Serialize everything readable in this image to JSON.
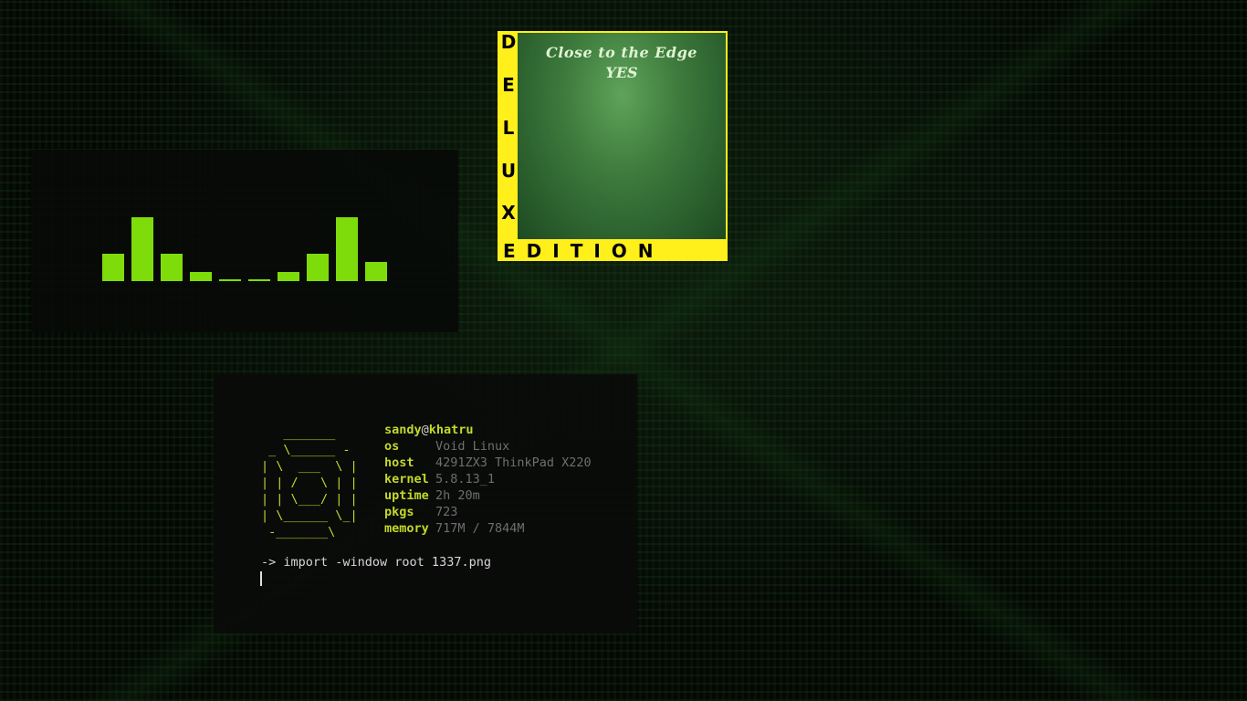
{
  "colors": {
    "accent_green": "#7fdc0b",
    "terminal_yellow": "#c2d92a",
    "album_yellow": "#ffef1a",
    "background": "#000000"
  },
  "visualizer": {
    "levels": [
      0.43,
      1.0,
      0.43,
      0.14,
      0.02,
      0.02,
      0.14,
      0.43,
      1.0,
      0.3
    ]
  },
  "album": {
    "title": "Close to the Edge",
    "band": "YES",
    "side_letters": [
      "D",
      "E",
      "L",
      "U",
      "X"
    ],
    "bottom_text": "EDITION"
  },
  "terminal": {
    "ascii_logo": "   _______\n _ \\______ -\n| \\  ___  \\ |\n| | /   \\ | |\n| | \\___/ | |\n| \\______ \\_|\n -_______\\",
    "user": "sandy",
    "at": "@",
    "host": "khatru",
    "info": [
      {
        "key": "os",
        "value": "Void Linux"
      },
      {
        "key": "host",
        "value": "4291ZX3 ThinkPad X220"
      },
      {
        "key": "kernel",
        "value": "5.8.13_1"
      },
      {
        "key": "uptime",
        "value": "2h 20m"
      },
      {
        "key": "pkgs",
        "value": "723"
      },
      {
        "key": "memory",
        "value": "717M / 7844M"
      }
    ],
    "prompt": "-> import -window root 1337.png"
  }
}
